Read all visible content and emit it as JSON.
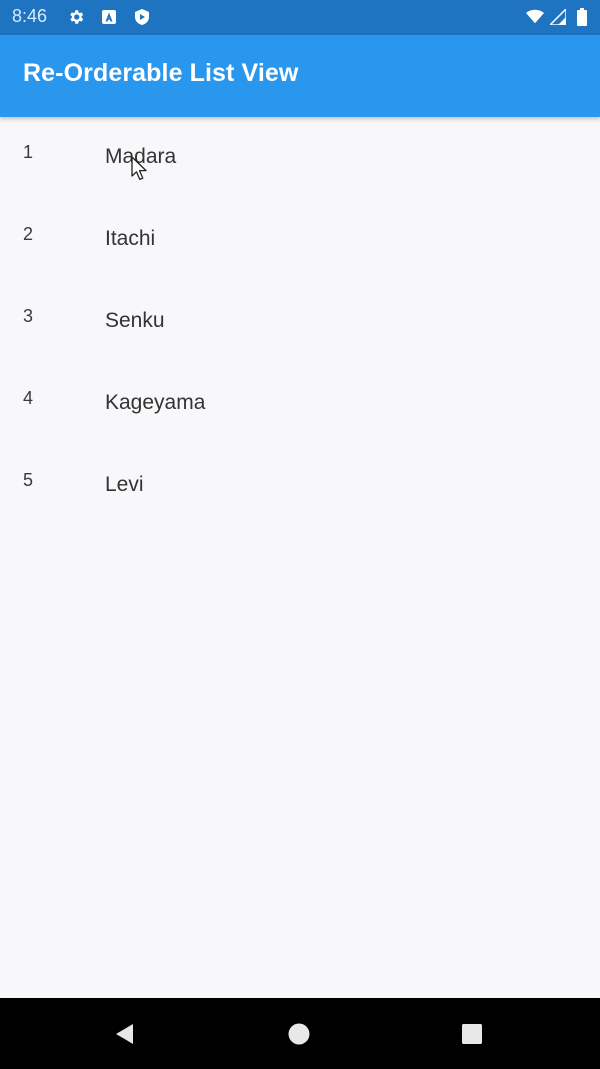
{
  "status_bar": {
    "time": "8:46",
    "icons": [
      "settings-icon",
      "app-a-icon",
      "shield-icon",
      "wifi-icon",
      "signal-icon",
      "battery-icon"
    ],
    "background": "#1e74c1"
  },
  "app_bar": {
    "title": "Re-Orderable List View",
    "background": "#2a97ee"
  },
  "list": {
    "items": [
      {
        "index": "1",
        "label": "Madara"
      },
      {
        "index": "2",
        "label": "Itachi"
      },
      {
        "index": "3",
        "label": "Senku"
      },
      {
        "index": "4",
        "label": "Kageyama"
      },
      {
        "index": "5",
        "label": "Levi"
      }
    ]
  },
  "nav_bar": {
    "buttons": [
      "back-icon",
      "home-icon",
      "recents-icon"
    ]
  }
}
